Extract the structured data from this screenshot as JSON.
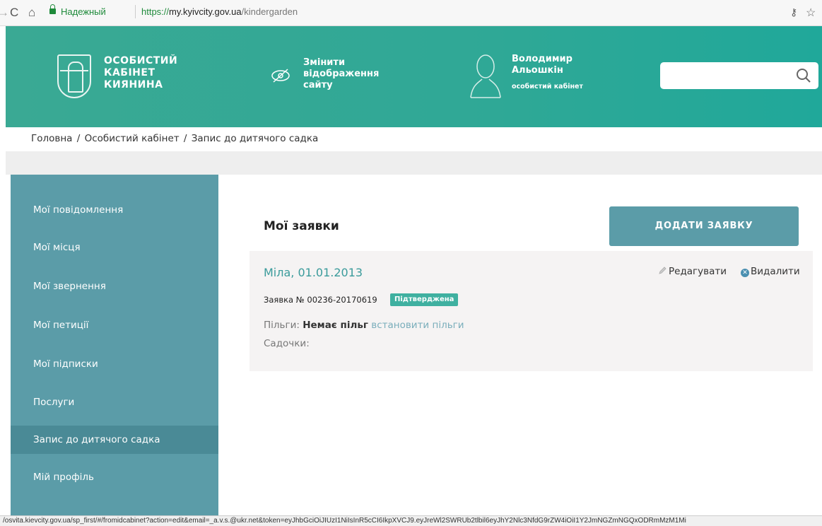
{
  "browser": {
    "secure_label": "Надежный",
    "url_scheme": "https://",
    "url_host": "my.kyivcity.gov.ua",
    "url_path": "/kindergarden"
  },
  "header": {
    "logo_line1": "ОСОБИСТИЙ",
    "logo_line2": "КАБІНЕТ",
    "logo_line3": "КИЯНИНА",
    "vis_line1": "Змінити",
    "vis_line2": "відображення",
    "vis_line3": "сайту",
    "user_first": "Володимир",
    "user_last": "Альошкін",
    "user_cabinet": "особистий кабінет",
    "search_placeholder": ""
  },
  "breadcrumb": {
    "items": [
      "Головна",
      "Особистий кабінет",
      "Запис до дитячого садка"
    ]
  },
  "sidebar": {
    "items": [
      {
        "label": "Мої повідомлення"
      },
      {
        "label": "Мої місця"
      },
      {
        "label": "Мої звернення"
      },
      {
        "label": "Мої петиції"
      },
      {
        "label": "Мої підписки"
      },
      {
        "label": "Послуги"
      },
      {
        "label": "Запис до дитячого садка"
      },
      {
        "label": "Мій профіль"
      }
    ]
  },
  "main": {
    "title": "Мої заявки",
    "add_button": "ДОДАТИ ЗАЯВКУ",
    "application": {
      "name": "Міла, 01.01.2013",
      "edit_label": "Редагувати",
      "delete_label": "Видалити",
      "number": "Заявка № 00236-20170619",
      "status": "Підтверджена",
      "benefits_label": "Пільги:",
      "benefits_value": "Немає пільг",
      "benefits_link": "встановити пільги",
      "gardens_label": "Садочки:"
    }
  },
  "statusbar": {
    "url": "/osvita.kievcity.gov.ua/sp_first/#/fromidcabinet?action=edit&email=_a.v.s.@ukr.net&token=eyJhbGciOiJIUzI1NiIsInR5cCI6IkpXVCJ9.eyJreWl2SWRUb2tlbil6eyJhY2Nlc3NfdG9rZW4iOiI1Y2JmNGZmNGQxODRmMzM1Mi"
  },
  "colors": {
    "header": "#2fa896",
    "sidebar": "#5b9ca8",
    "sidebar_active": "#4a8a96",
    "badge": "#3fb0a0",
    "link": "#3a9b9b"
  }
}
